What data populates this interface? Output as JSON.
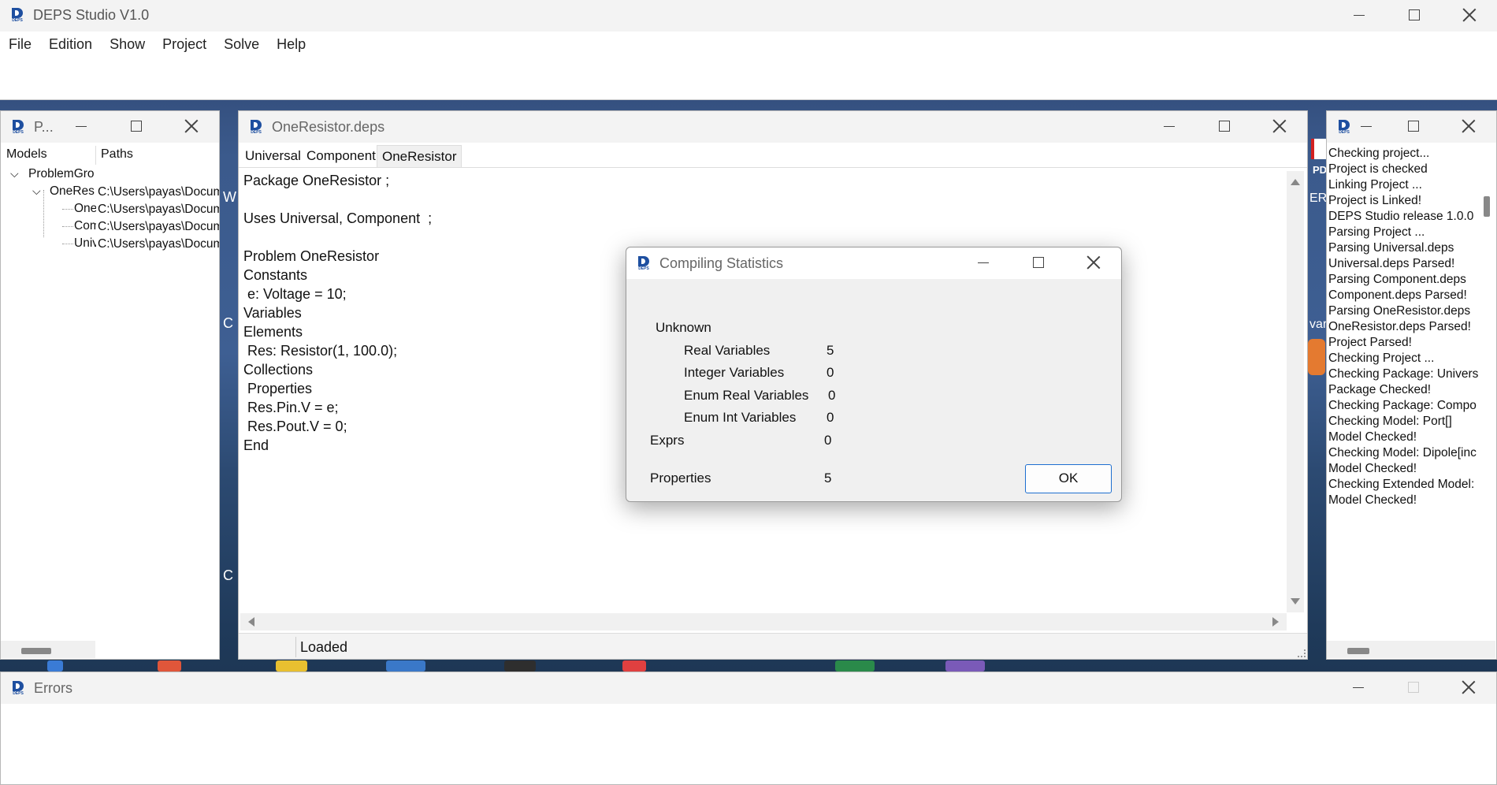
{
  "main_window": {
    "title": "DEPS Studio V1.0",
    "menu": [
      "File",
      "Edition",
      "Show",
      "Project",
      "Solve",
      "Help"
    ]
  },
  "project_panel": {
    "title": "P...",
    "columns": [
      "Models",
      "Paths"
    ],
    "tree": [
      {
        "label": "ProblemGro",
        "path": ""
      },
      {
        "label": "OneRes",
        "path": "C:\\Users\\payas\\Docum"
      },
      {
        "label": "One",
        "path": "C:\\Users\\payas\\Docum"
      },
      {
        "label": "Com",
        "path": "C:\\Users\\payas\\Docum"
      },
      {
        "label": "Univ",
        "path": "C:\\Users\\payas\\Docum"
      }
    ]
  },
  "editor": {
    "title": "OneResistor.deps",
    "tabs": [
      "Universal",
      "Component",
      "OneResistor"
    ],
    "active_tab": "OneResistor",
    "lines": [
      "Package OneResistor ;",
      "",
      "Uses Universal, Component  ;",
      "",
      "Problem OneResistor",
      "Constants",
      " e: Voltage = 10;",
      "Variables",
      "Elements",
      " Res: Resistor(1, 100.0);",
      "Collections",
      " Properties",
      " Res.Pin.V = e;",
      " Res.Pout.V = 0;",
      "End"
    ],
    "status": "Loaded"
  },
  "log_panel": {
    "lines": [
      "Checking project...",
      "Project is checked",
      "Linking Project ...",
      "Project is Linked!",
      "",
      "DEPS Studio release 1.0.0",
      "",
      "Parsing Project ...",
      "Parsing Universal.deps",
      "Universal.deps Parsed!",
      "",
      "Parsing Component.deps",
      "Component.deps Parsed!",
      "",
      "Parsing OneResistor.deps",
      "OneResistor.deps Parsed!",
      "",
      "Project Parsed!",
      "",
      "Checking Project ...",
      "Checking Package: Univers",
      "Package Checked!",
      "",
      "Checking Package: Compo",
      "Checking Model: Port[]",
      "Model Checked!",
      "",
      "Checking Model: Dipole[inc",
      "Model Checked!",
      "",
      "Checking Extended Model:",
      "Model Checked!"
    ]
  },
  "dialog": {
    "title": "Compiling Statistics",
    "unknown_label": "Unknown",
    "rows": [
      {
        "label": "Real Variables",
        "value": "5"
      },
      {
        "label": "Integer Variables",
        "value": "0"
      },
      {
        "label": "Enum Real Variables",
        "value": "0"
      },
      {
        "label": "Enum Int Variables",
        "value": "0"
      }
    ],
    "exprs_label": "Exprs",
    "exprs_value": "0",
    "properties_label": "Properties",
    "properties_value": "5",
    "ok_label": "OK"
  },
  "errors_panel": {
    "title": "Errors"
  },
  "desktop_fragments": [
    "W",
    "C",
    "C",
    "PD",
    "ER",
    "var"
  ]
}
